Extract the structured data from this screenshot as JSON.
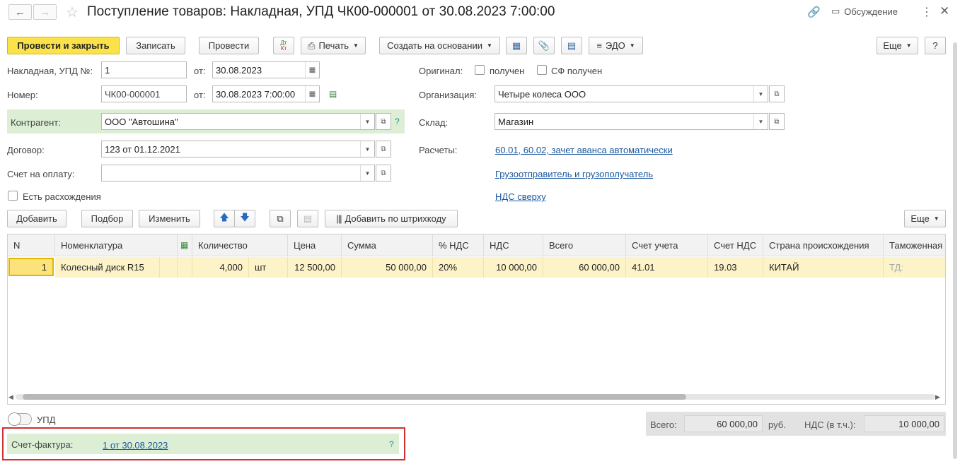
{
  "header": {
    "title": "Поступление товаров: Накладная, УПД ЧК00-000001 от 30.08.2023 7:00:00",
    "discussion": "Обсуждение"
  },
  "toolbar": {
    "post_close": "Провести и закрыть",
    "write": "Записать",
    "post": "Провести",
    "dt_kt": "Дт Кт",
    "print": "Печать",
    "create_based": "Создать на основании",
    "edo": "ЭДО",
    "more": "Еще",
    "help": "?"
  },
  "form": {
    "invoice_label": "Накладная, УПД №:",
    "invoice_value": "1",
    "from_label": "от:",
    "invoice_date": "30.08.2023",
    "number_label": "Номер:",
    "number_value": "ЧК00-000001",
    "number_date": "30.08.2023  7:00:00",
    "counterparty_label": "Контрагент:",
    "counterparty_value": "ООО \"Автошина\"",
    "contract_label": "Договор:",
    "contract_value": "123 от 01.12.2021",
    "payment_account_label": "Счет на оплату:",
    "payment_account_value": "",
    "discrepancies_label": "Есть расхождения",
    "original_label": "Оригинал:",
    "received_label": "получен",
    "sf_received_label": "СФ получен",
    "org_label": "Организация:",
    "org_value": "Четыре колеса ООО",
    "warehouse_label": "Склад:",
    "warehouse_value": "Магазин",
    "settlements_label": "Расчеты:",
    "settlements_link": "60.01, 60.02, зачет аванса автоматически",
    "shipper_link": "Грузоотправитель и грузополучатель",
    "vat_link": "НДС сверху",
    "help": "?"
  },
  "table_toolbar": {
    "add": "Добавить",
    "pick": "Подбор",
    "edit": "Изменить",
    "add_barcode": "Добавить по штрихкоду",
    "more": "Еще"
  },
  "table": {
    "headers": [
      "N",
      "Номенклатура",
      "Количество",
      "Цена",
      "Сумма",
      "% НДС",
      "НДС",
      "Всего",
      "Счет учета",
      "Счет НДС",
      "Страна происхождения",
      "Таможенная"
    ],
    "rows": [
      {
        "n": "1",
        "item": "Колесный диск R15",
        "qty": "4,000",
        "unit": "шт",
        "price": "12 500,00",
        "sum": "50 000,00",
        "vat_rate": "20%",
        "vat": "10 000,00",
        "total": "60 000,00",
        "account": "41.01",
        "vat_account": "19.03",
        "country": "КИТАЙ",
        "customs": "ТД:"
      }
    ]
  },
  "footer": {
    "upd_label": "УПД",
    "total_label": "Всего:",
    "total_value": "60 000,00",
    "currency": "руб.",
    "vat_incl_label": "НДС (в т.ч.):",
    "vat_incl_value": "10 000,00",
    "invoice_label": "Счет-фактура:",
    "invoice_link": "1 от 30.08.2023",
    "help": "?"
  }
}
